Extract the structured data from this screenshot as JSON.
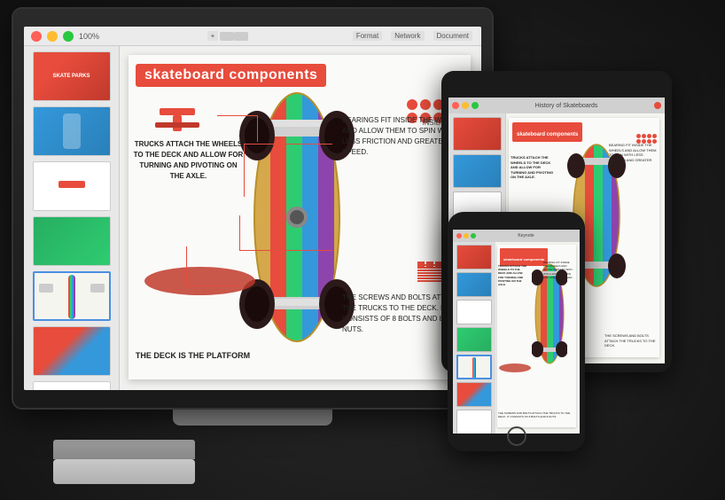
{
  "app": {
    "title": "skateboard components",
    "toolbar": {
      "zoom": "100%",
      "add_btn": "Add Slide",
      "format_btn": "Format",
      "network_btn": "Network",
      "document_btn": "Document"
    }
  },
  "slide": {
    "title": "skateboard components",
    "labels": {
      "trucks": "TRUCKS ATTACH THE WHEELS TO THE DECK AND ALLOW FOR TURNING AND PIVOTING ON THE AXLE.",
      "bearings": "BEARINGS FIT INSIDE THE WHEELS AND ALLOW THEM TO SPIN WITH LESS FRICTION AND GREATER SPEED.",
      "screws": "THE SCREWS AND BOLTS ATTACH THE TRUCKS TO THE DECK. IT CONSISTS OF 8 BOLTS AND 8 NUTS.",
      "deck": "THE DECK IS THE PLATFORM",
      "inside_the": "INSIDE THE"
    }
  },
  "devices": {
    "ipad_title": "History of Skateboards",
    "iphone_title": "skateboard components"
  },
  "colors": {
    "red": "#e74c3c",
    "blue": "#3498db",
    "green": "#2ecc71",
    "purple": "#8e44ad",
    "dark": "#1a1a1a",
    "accent": "#4a90e2"
  }
}
